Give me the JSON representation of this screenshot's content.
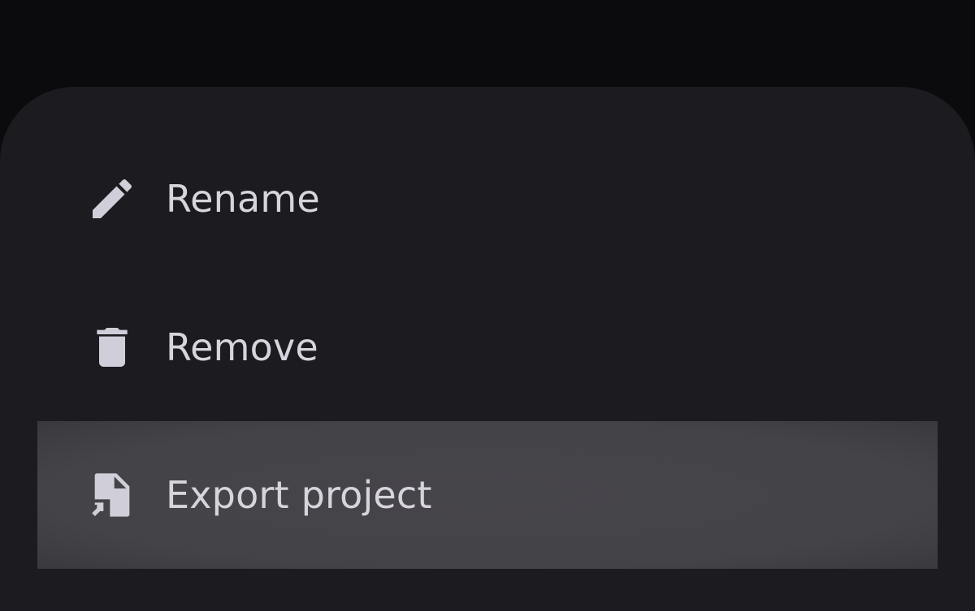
{
  "menu": {
    "items": [
      {
        "label": "Rename",
        "icon": "pencil-icon"
      },
      {
        "label": "Remove",
        "icon": "trash-icon"
      },
      {
        "label": "Export project",
        "icon": "file-export-icon",
        "highlighted": true
      }
    ]
  },
  "colors": {
    "scrim": "#0b0b0d",
    "sheet": "#1c1b20",
    "highlight": "#444348",
    "text": "#d6d4dc",
    "icon": "#d0ced8"
  }
}
